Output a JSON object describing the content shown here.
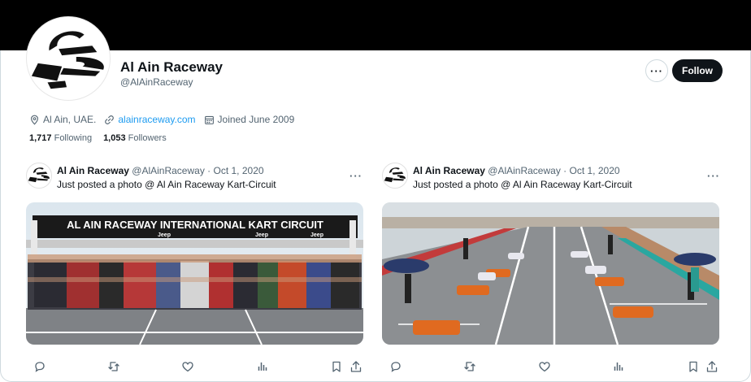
{
  "profile": {
    "name": "Al Ain Raceway",
    "handle": "@AlAinRaceway",
    "location": "Al Ain, UAE.",
    "website": "alainraceway.com",
    "joined": "Joined June 2009",
    "following_count": "1,717",
    "following_label": "Following",
    "followers_count": "1,053",
    "followers_label": "Followers",
    "follow_label": "Follow",
    "more_label": "···"
  },
  "posts": [
    {
      "name": "Al Ain Raceway",
      "handle": "@AlAinRaceway",
      "date": "· Oct 1, 2020",
      "text": "Just posted a photo @ Al Ain Raceway Kart-Circuit",
      "more": "···",
      "photo_banner": "AL AIN RACEWAY INTERNATIONAL KART CIRCUIT",
      "photo_sponsor_1": "Jeep",
      "photo_sponsor_2": "Jeep",
      "photo_sponsor_3": "Jeep"
    },
    {
      "name": "Al Ain Raceway",
      "handle": "@AlAinRaceway",
      "date": "· Oct 1, 2020",
      "text": "Just posted a photo @ Al Ain Raceway Kart-Circuit",
      "more": "···"
    }
  ],
  "icons": {
    "location": "location-pin-icon",
    "link": "link-icon",
    "calendar": "calendar-icon",
    "reply": "reply-icon",
    "retweet": "retweet-icon",
    "like": "heart-icon",
    "views": "bar-chart-icon",
    "bookmark": "bookmark-icon",
    "share": "share-icon"
  },
  "colors": {
    "link": "#1d9bf0",
    "muted": "#536471",
    "text": "#0f1419",
    "follow_bg": "#0f1419"
  }
}
